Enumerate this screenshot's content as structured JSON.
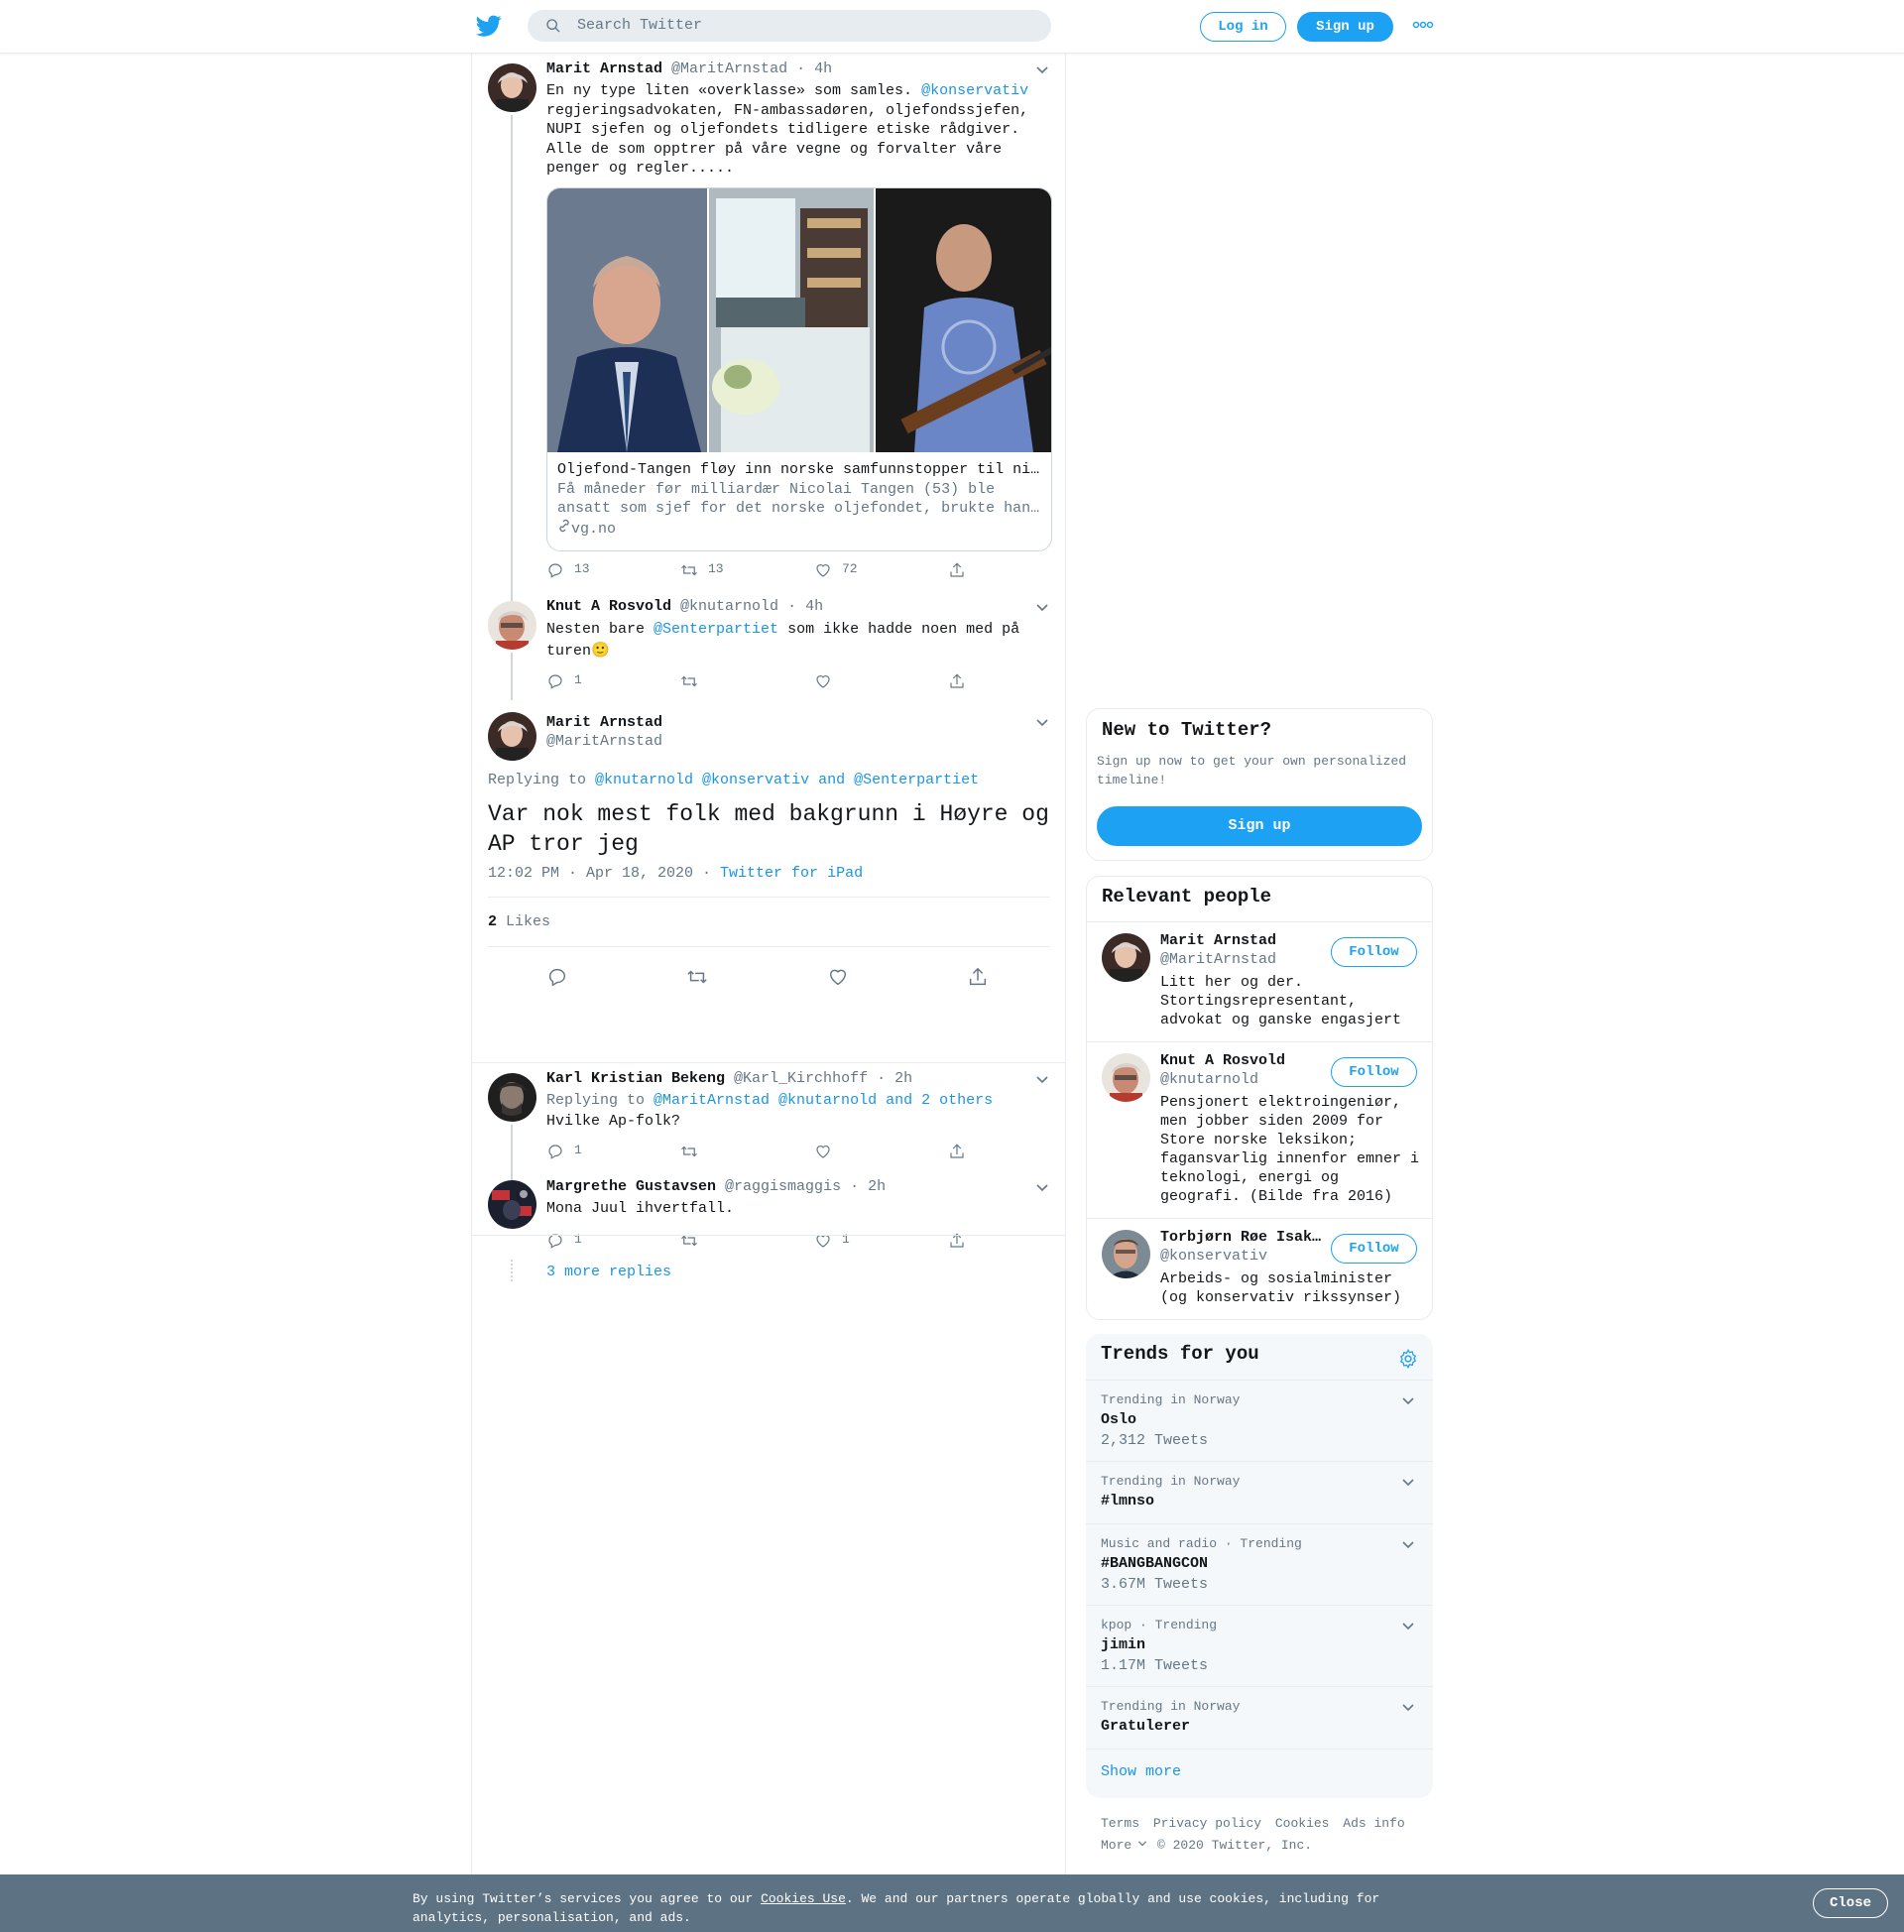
{
  "header": {
    "search_placeholder": "Search Twitter",
    "login_label": "Log in",
    "signup_label": "Sign up"
  },
  "tweets": [
    {
      "name": "Marit Arnstad",
      "handle": "@MaritArnstad",
      "time": "· 4h",
      "text_before": "En ny type liten «overklasse» som samles. ",
      "mention": "@konservativ",
      "text_after": "\nregjeringsadvokaten, FN-ambassadøren, oljefondssjefen,\nNUPI sjefen og oljefondets tidligere etiske rådgiver.\nAlle de som opptrer på våre vegne og forvalter våre\npenger og regler.....",
      "card": {
        "title": "Oljefond-Tangen fløy inn norske samfunnstopper til ni…",
        "description_1": "Få måneder før milliardær Nicolai Tangen (53) ble",
        "description_2": "ansatt som sjef for det norske oljefondet, brukte han…",
        "domain": "vg.no"
      },
      "replies": "13",
      "retweets": "13",
      "likes": "72"
    },
    {
      "name": "Knut A Rosvold",
      "handle": "@knutarnold",
      "time": "· 4h",
      "text_before": "Nesten bare ",
      "mention": "@Senterpartiet",
      "text_after": " som ikke hadde noen med på\nturen🙂",
      "replies": "1",
      "retweets": "",
      "likes": ""
    }
  ],
  "focused": {
    "name": "Marit Arnstad",
    "handle": "@MaritArnstad",
    "replying_prefix": "Replying to ",
    "replying_to": "@knutarnold @konservativ and @Senterpartiet",
    "text": "Var nok mest folk med bakgrunn i Høyre og AP tror jeg",
    "timestamp": "12:02 PM · Apr 18, 2020 · ",
    "source": "Twitter for iPad",
    "likes_count": "2",
    "likes_label": "Likes"
  },
  "replies": [
    {
      "name": "Karl Kristian Bekeng",
      "handle": "@Karl_Kirchhoff",
      "time": "· 2h",
      "replying_prefix": "Replying to ",
      "replying_to": "@MaritArnstad @knutarnold and 2 others",
      "text": "Hvilke Ap-folk?",
      "replies": "1",
      "retweets": "",
      "likes": ""
    },
    {
      "name": "Margrethe Gustavsen",
      "handle": "@raggismaggis",
      "time": "· 2h",
      "text": "Mona Juul ihvertfall.",
      "replies": "1",
      "retweets": "",
      "likes": "1"
    }
  ],
  "more_replies": "3 more replies",
  "sidebar": {
    "new_title": "New to Twitter?",
    "new_desc": "Sign up now to get your own personalized timeline!",
    "new_signup": "Sign up",
    "relevant_title": "Relevant people",
    "follow_label": "Follow",
    "people": [
      {
        "name": "Marit Arnstad",
        "handle": "@MaritArnstad",
        "bio": "Litt her og der. Stortingsrepresentant, advokat og ganske engasjert"
      },
      {
        "name": "Knut A Rosvold",
        "handle": "@knutarnold",
        "bio": "Pensjonert elektroingeniør, men jobber siden 2009 for Store norske leksikon; fagansvarlig innenfor emner i teknologi, energi og geografi. (Bilde fra 2016)"
      },
      {
        "name": "Torbjørn Røe Isaksen",
        "handle": "@konservativ",
        "bio": "Arbeids- og sosialminister (og konservativ rikssynser)"
      }
    ],
    "trends_title": "Trends for you",
    "trends": [
      {
        "context": "Trending in Norway",
        "name": "Oslo",
        "count": "2,312 Tweets"
      },
      {
        "context": "Trending in Norway",
        "name": "#lmnso",
        "count": ""
      },
      {
        "context": "Music and radio · Trending",
        "name": "#BANGBANGCON",
        "count": "3.67M Tweets"
      },
      {
        "context": "kpop · Trending",
        "name": "jimin",
        "count": "1.17M Tweets"
      },
      {
        "context": "Trending in Norway",
        "name": "Gratulerer",
        "count": ""
      }
    ],
    "show_more": "Show more"
  },
  "footer": {
    "links": [
      "Terms",
      "Privacy policy",
      "Cookies",
      "Ads info"
    ],
    "more": "More",
    "copyright": "© 2020 Twitter, Inc."
  },
  "cookie": {
    "text_1": "By using Twitter’s services you agree to our ",
    "link": "Cookies Use",
    "text_2": ". We and our partners operate globally and use cookies, including for analytics, personalisation, and ads.",
    "close": "Close"
  },
  "colors": {
    "brand": "#1da1f2",
    "link": "#1b95e0",
    "muted": "#657786",
    "cookie_bar": "#5d7283"
  }
}
